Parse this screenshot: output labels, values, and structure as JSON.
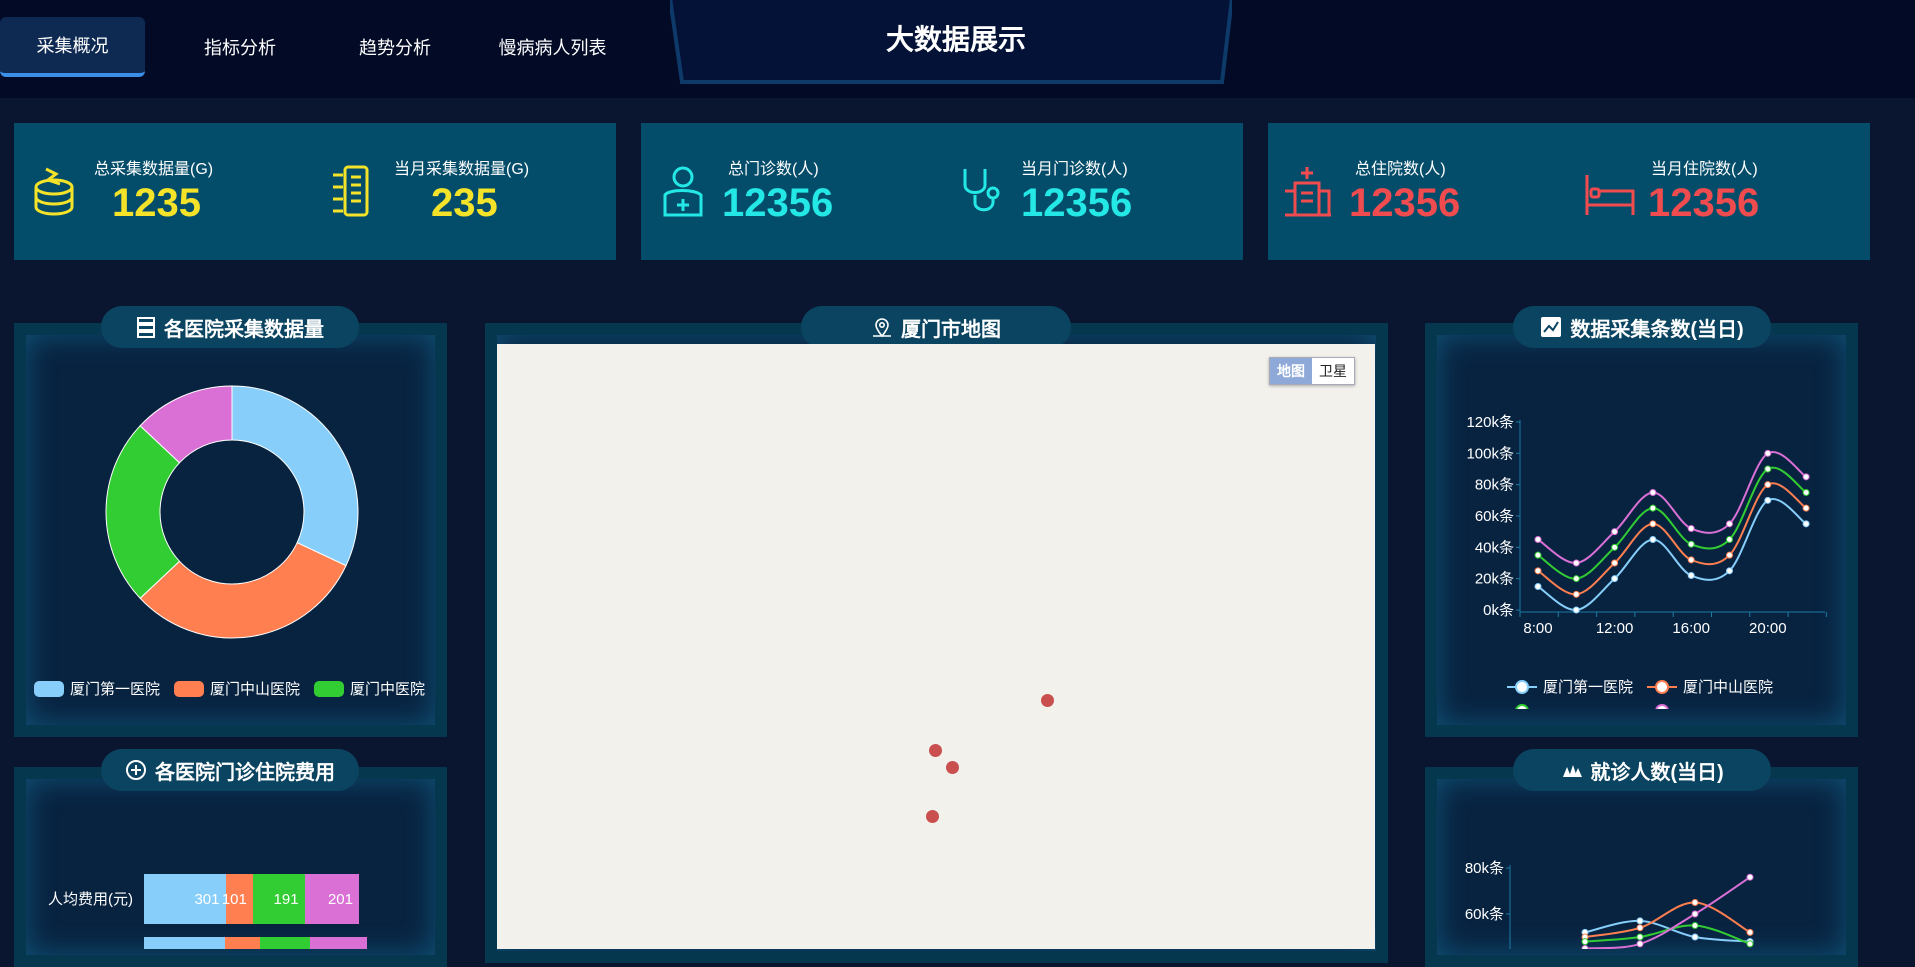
{
  "nav": {
    "tabs": [
      {
        "label": "采集概况",
        "active": true
      },
      {
        "label": "指标分析",
        "active": false
      },
      {
        "label": "趋势分析",
        "active": false
      },
      {
        "label": "慢病病人列表",
        "active": false
      }
    ],
    "title": "大数据展示"
  },
  "stats": [
    {
      "label": "总采集数据量(G)",
      "value": "1235",
      "color": "#f5e32a",
      "icon": "database-icon"
    },
    {
      "label": "当月采集数据量(G)",
      "value": "235",
      "color": "#f5e32a",
      "icon": "server-icon"
    },
    {
      "label": "总门诊数(人)",
      "value": "12356",
      "color": "#24e8e6",
      "icon": "doctor-icon"
    },
    {
      "label": "当月门诊数(人)",
      "value": "12356",
      "color": "#24e8e6",
      "icon": "stethoscope-icon"
    },
    {
      "label": "总住院数(人)",
      "value": "12356",
      "color": "#f04b4f",
      "icon": "hospital-icon"
    },
    {
      "label": "当月住院数(人)",
      "value": "12356",
      "color": "#f04b4f",
      "icon": "bed-icon"
    }
  ],
  "panels": {
    "donut_title": "各医院采集数据量",
    "cost_title": "各医院门诊住院费用",
    "map_title": "厦门市地图",
    "collect_title": "数据采集条数(当日)",
    "visits_title": "就诊人数(当日)"
  },
  "map": {
    "btn_map": "地图",
    "btn_satellite": "卫星"
  },
  "colors": {
    "blue": "#87cefa",
    "orange": "#ff7f50",
    "green": "#32cd32",
    "pink": "#da70d6",
    "accent": "#3b8fe6"
  },
  "chart_data": [
    {
      "type": "pie",
      "title": "各医院采集数据量",
      "series": [
        {
          "name": "厦门第一医院",
          "value": 32
        },
        {
          "name": "厦门中山医院",
          "value": 31
        },
        {
          "name": "厦门中医院",
          "value": 24
        },
        {
          "name": "",
          "value": 13
        }
      ],
      "legend": [
        "厦门第一医院",
        "厦门中山医院",
        "厦门中医院"
      ]
    },
    {
      "type": "line",
      "title": "数据采集条数(当日)",
      "x_ticks": [
        "8:00",
        "12:00",
        "16:00",
        "20:00"
      ],
      "y_ticks": [
        "0k条",
        "20k条",
        "40k条",
        "60k条",
        "80k条",
        "100k条",
        "120k条"
      ],
      "ylim": [
        0,
        120
      ],
      "x": [
        "8:00",
        "10:00",
        "12:00",
        "14:00",
        "16:00",
        "18:00",
        "20:00",
        "22:00"
      ],
      "series": [
        {
          "name": "厦门第一医院",
          "values": [
            15,
            0,
            20,
            45,
            22,
            25,
            70,
            55
          ]
        },
        {
          "name": "厦门中山医院",
          "values": [
            25,
            10,
            30,
            55,
            32,
            35,
            80,
            65
          ]
        },
        {
          "name": "",
          "values": [
            35,
            20,
            40,
            65,
            42,
            45,
            90,
            75
          ]
        },
        {
          "name": "",
          "values": [
            45,
            30,
            50,
            75,
            52,
            55,
            100,
            85
          ]
        }
      ],
      "legend": [
        "厦门第一医院",
        "厦门中山医院"
      ]
    },
    {
      "type": "bar",
      "title": "各医院门诊住院费用",
      "categories": [
        "人均费用(元)"
      ],
      "series": [
        {
          "name": "厦门第一医院",
          "values": [
            301
          ]
        },
        {
          "name": "厦门中山医院",
          "values": [
            101
          ]
        },
        {
          "name": "厦门中医院",
          "values": [
            191
          ]
        },
        {
          "name": "",
          "values": [
            201
          ]
        }
      ]
    },
    {
      "type": "line",
      "title": "就诊人数(当日)",
      "y_ticks": [
        "60k条",
        "80k条"
      ],
      "series": [
        {
          "name": "",
          "values": [
            52,
            57,
            50,
            48
          ]
        },
        {
          "name": "",
          "values": [
            50,
            54,
            65,
            52
          ]
        },
        {
          "name": "",
          "values": [
            48,
            50,
            55,
            47
          ]
        },
        {
          "name": "",
          "values": [
            45,
            47,
            60,
            76
          ]
        }
      ]
    }
  ]
}
